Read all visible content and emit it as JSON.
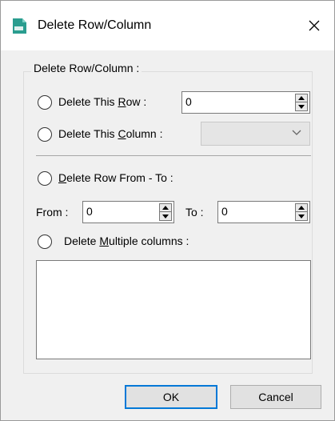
{
  "window": {
    "title": "Delete Row/Column",
    "close_glyph": "✕",
    "icon": "csv-file-icon"
  },
  "group": {
    "label": "Delete Row/Column :"
  },
  "delete_row": {
    "label_pre": "Delete This ",
    "label_u": "R",
    "label_post": "ow :",
    "value": "0"
  },
  "delete_column": {
    "label_pre": "Delete This ",
    "label_u": "C",
    "label_post": "olumn :",
    "selected": ""
  },
  "delete_range": {
    "label_u": "D",
    "label_post": "elete Row From - To :",
    "from_label": "From :",
    "from_value": "0",
    "to_label": "To :",
    "to_value": "0"
  },
  "delete_multiple": {
    "label_pre": "Delete ",
    "label_u": "M",
    "label_post": "ultiple columns :",
    "items": []
  },
  "buttons": {
    "ok": "OK",
    "cancel": "Cancel"
  },
  "colors": {
    "accent": "#0078d7",
    "icon_teal": "#2a9d8f"
  }
}
